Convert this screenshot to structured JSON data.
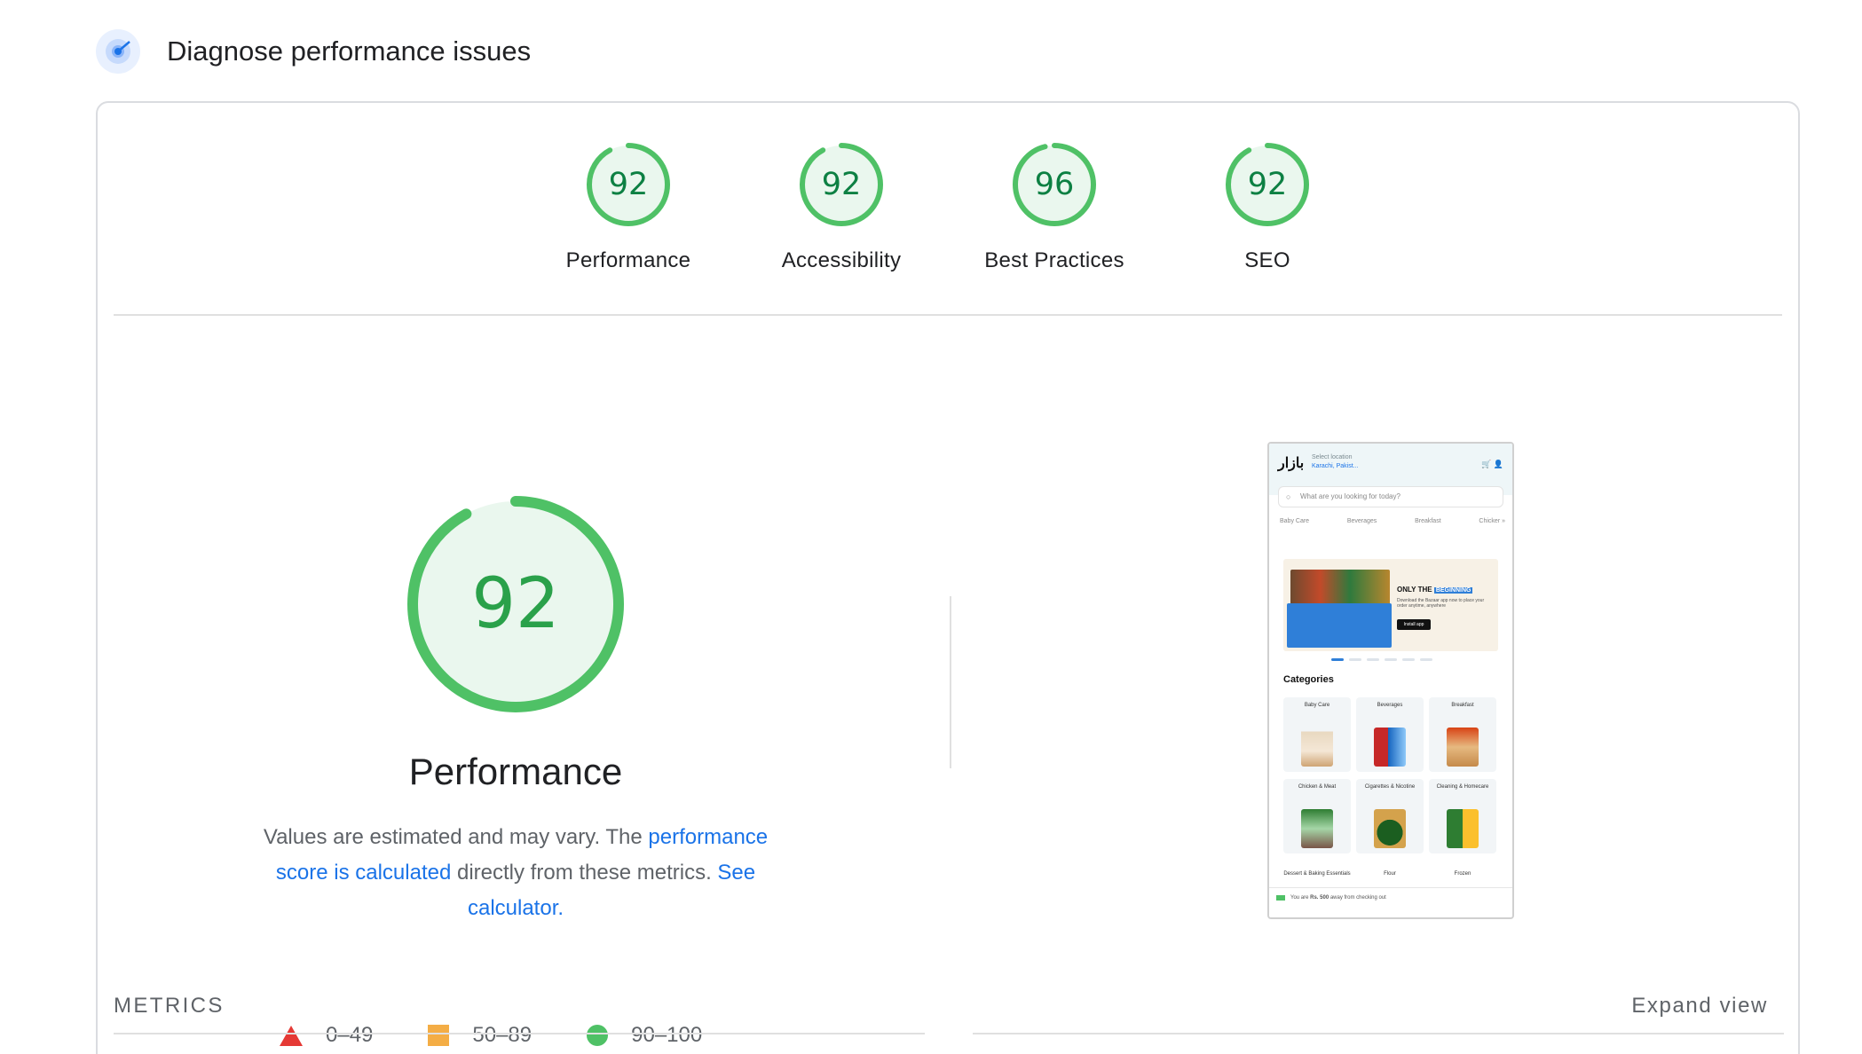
{
  "header": {
    "title": "Diagnose performance issues",
    "icon": "lighthouse-icon"
  },
  "gauges": [
    {
      "score": "92",
      "label": "Performance",
      "value": 92
    },
    {
      "score": "92",
      "label": "Accessibility",
      "value": 92
    },
    {
      "score": "96",
      "label": "Best Practices",
      "value": 96
    },
    {
      "score": "92",
      "label": "SEO",
      "value": 92
    }
  ],
  "performance": {
    "score": "92",
    "value": 92,
    "title": "Performance",
    "desc_1": "Values are estimated and may vary. The ",
    "link_1": "performance score is calculated",
    "desc_2": " directly from these metrics. ",
    "link_2": "See calculator."
  },
  "legend": [
    {
      "range": "0–49",
      "shape": "triangle",
      "color": "#e53935"
    },
    {
      "range": "50–89",
      "shape": "square",
      "color": "#f4ad45"
    },
    {
      "range": "90–100",
      "shape": "circle",
      "color": "#4fc166"
    }
  ],
  "screenshot": {
    "logo": "بازار",
    "location_label": "Select location",
    "location_value": "Karachi, Pakist...",
    "search_placeholder": "What are you looking for today?",
    "nav": [
      "Baby Care",
      "Beverages",
      "Breakfast",
      "Chicker »"
    ],
    "banner_title": "ONLY THE",
    "banner_badge": "BEGINNING",
    "banner_sub": "Download the Bazaar app now to place your order anytime, anywhere",
    "banner_button": "Install app",
    "categories_title": "Categories",
    "tiles": [
      "Baby Care",
      "Beverages",
      "Breakfast",
      "Chicken & Meat",
      "Cigarettes & Nicotine",
      "Cleaning & Homecare"
    ],
    "row3": [
      "Dessert & Baking Essentials",
      "Flour",
      "Frozen"
    ],
    "footer_prefix": "You are ",
    "footer_amount": "Rs. 500",
    "footer_suffix": " away from checking out"
  },
  "metrics": {
    "label": "METRICS",
    "expand": "Expand view"
  },
  "colors": {
    "pass": "#4fc166",
    "pass_text": "#0d8043",
    "link": "#1a73e8"
  }
}
